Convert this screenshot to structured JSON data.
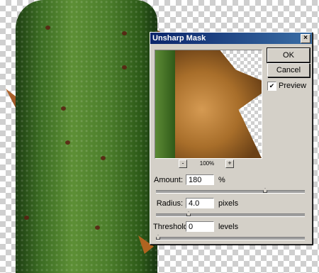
{
  "dialog": {
    "title": "Unsharp Mask",
    "close_label": "×",
    "ok_label": "OK",
    "cancel_label": "Cancel",
    "preview_label": "Preview",
    "preview_checked": true,
    "check_mark": "✔",
    "zoom_out_label": "-",
    "zoom_in_label": "+",
    "zoom_level": "100%",
    "amount": {
      "label": "Amount:",
      "value": "180",
      "unit": "%",
      "slider_fraction": 0.74
    },
    "radius": {
      "label": "Radius:",
      "value": "4.0",
      "unit": "pixels",
      "slider_fraction": 0.21
    },
    "threshold": {
      "label": "Threshold:",
      "value": "0",
      "unit": "levels",
      "slider_fraction": 0.0
    }
  },
  "colors": {
    "titlebar_start": "#0a246a",
    "titlebar_end": "#3a6ea5",
    "dialog_face": "#d4d0c8",
    "stem_green": "#4c7e2b",
    "thorn_brown": "#a86e2a"
  }
}
